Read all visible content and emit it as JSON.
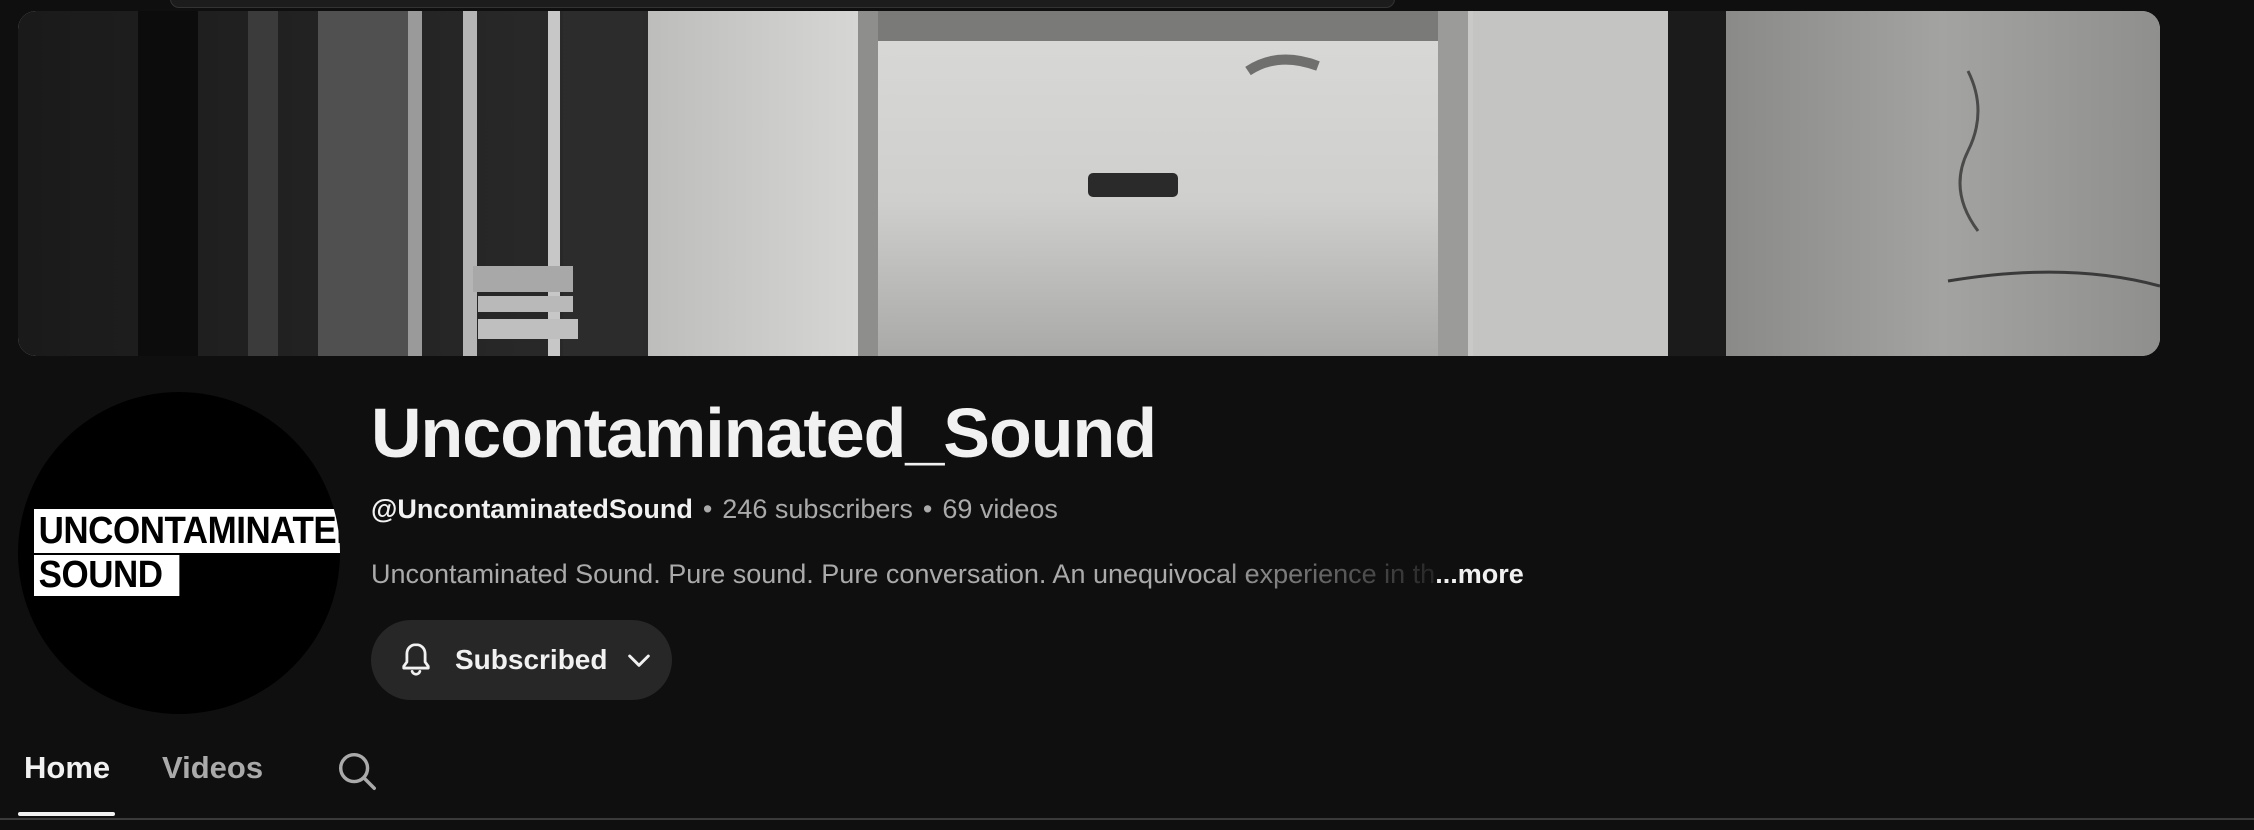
{
  "channel": {
    "name": "Uncontaminated_Sound",
    "handle": "@UncontaminatedSound",
    "subscribers": "246 subscribers",
    "videos": "69 videos",
    "description": "Uncontaminated Sound. Pure sound. Pure conversation. An unequivocal experience in th",
    "more_label": "...more",
    "logo_line1": "UNCONTAMINATED",
    "logo_line2": "SOUND"
  },
  "subscribe": {
    "label": "Subscribed",
    "icon": "bell-icon",
    "dropdown_icon": "chevron-down-icon"
  },
  "tabs": [
    {
      "label": "Home",
      "active": true
    },
    {
      "label": "Videos",
      "active": false
    }
  ],
  "tab_search_icon": "search-icon",
  "colors": {
    "background": "#0f0f0f",
    "button_bg": "#272727",
    "primary_text": "#f1f1f1",
    "secondary_text": "#aaaaaa"
  }
}
